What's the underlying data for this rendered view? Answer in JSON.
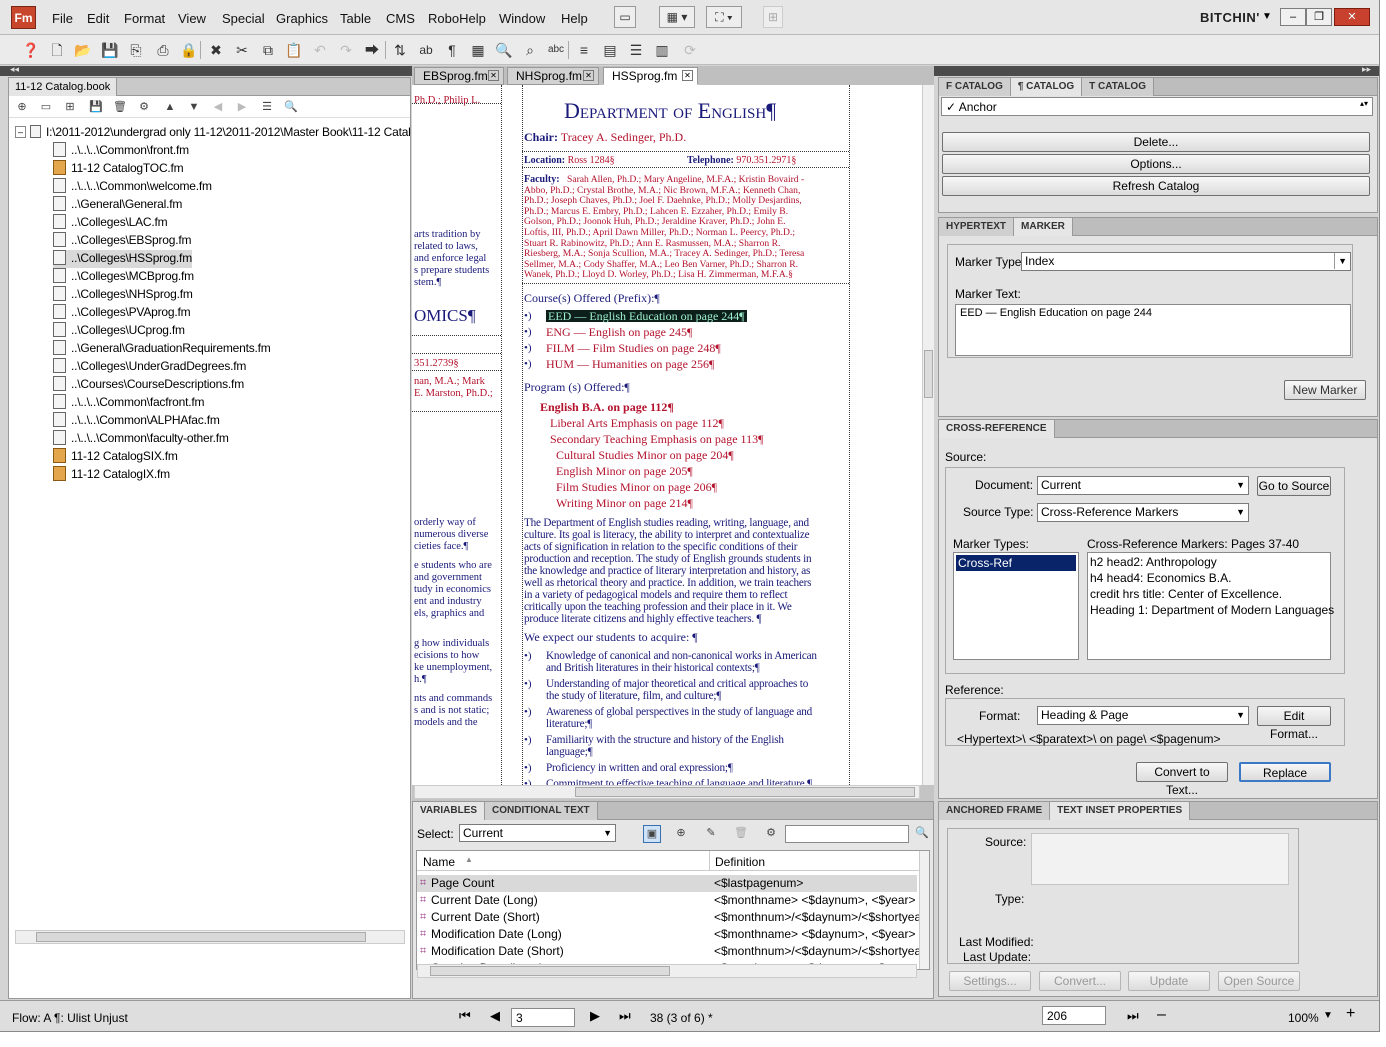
{
  "app": {
    "logo": "Fm",
    "workspace": "BITCHIN'"
  },
  "menu": [
    "File",
    "Edit",
    "Format",
    "View",
    "Special",
    "Graphics",
    "Table",
    "CMS",
    "RoboHelp",
    "Window",
    "Help"
  ],
  "book": {
    "tab": "11-12 Catalog.book",
    "root": "I:\\2011-2012\\undergrad only 11-12\\2011-2012\\Master Book\\11-12 Catalo",
    "files": [
      {
        "name": "..\\..\\..\\Common\\front.fm",
        "fm": false
      },
      {
        "name": "11-12 CatalogTOC.fm",
        "fm": true
      },
      {
        "name": "..\\..\\..\\Common\\welcome.fm",
        "fm": false
      },
      {
        "name": "..\\General\\General.fm",
        "fm": false
      },
      {
        "name": "..\\Colleges\\LAC.fm",
        "fm": false
      },
      {
        "name": "..\\Colleges\\EBSprog.fm",
        "fm": false
      },
      {
        "name": "..\\Colleges\\HSSprog.fm",
        "fm": false,
        "selected": true
      },
      {
        "name": "..\\Colleges\\MCBprog.fm",
        "fm": false
      },
      {
        "name": "..\\Colleges\\NHSprog.fm",
        "fm": false
      },
      {
        "name": "..\\Colleges\\PVAprog.fm",
        "fm": false
      },
      {
        "name": "..\\Colleges\\UCprog.fm",
        "fm": false
      },
      {
        "name": "..\\General\\GraduationRequirements.fm",
        "fm": false
      },
      {
        "name": "..\\Colleges\\UnderGradDegrees.fm",
        "fm": false
      },
      {
        "name": "..\\Courses\\CourseDescriptions.fm",
        "fm": false
      },
      {
        "name": "..\\..\\..\\Common\\facfront.fm",
        "fm": false
      },
      {
        "name": "..\\..\\..\\Common\\ALPHAfac.fm",
        "fm": false
      },
      {
        "name": "..\\..\\..\\Common\\faculty-other.fm",
        "fm": false
      },
      {
        "name": "11-12 CatalogSIX.fm",
        "fm": true
      },
      {
        "name": "11-12 CatalogIX.fm",
        "fm": true
      }
    ]
  },
  "doctabs": [
    "EBSprog.fm",
    "NHSprog.fm",
    "HSSprog.fm"
  ],
  "doc": {
    "left_frag": [
      "Ph.D.; Philip L.",
      "arts tradition by",
      "related to laws,",
      "and enforce legal",
      "s prepare students",
      "stem.¶",
      "OMICS¶",
      "351.2739§",
      "nan, M.A.; Mark",
      "E. Marston, Ph.D.;",
      "orderly way of",
      "numerous diverse",
      "cieties face.¶",
      "e students who are",
      "and government",
      "tudy in economics",
      "ent and industry",
      "els, graphics and",
      "g how individuals",
      "ecisions to how",
      "ke unemployment,",
      "h.¶",
      "nts and commands",
      "s and is not static;",
      "models and the"
    ],
    "title": "Department of English¶",
    "chair_label": "Chair:",
    "chair": "Tracey A. Sedinger, Ph.D.",
    "loc_label": "Location:",
    "loc": "Ross 1284§",
    "tel_label": "Telephone:",
    "tel": "970.351.2971§",
    "faculty_label": "Faculty:",
    "faculty": [
      "Sarah Allen, Ph.D.; Mary Angeline, M.F.A.; Kristin Bovaird -",
      "Abbo, Ph.D.; Crystal Brothe, M.A.; Nic Brown, M.F.A.; Kenneth Chan,",
      "Ph.D.; Joseph Chaves, Ph.D.; Joel F. Daehnke, Ph.D.; Molly Desjardins,",
      "Ph.D.; Marcus E. Embry, Ph.D.; Lahcen E. Ezzaher, Ph.D.; Emily B.",
      "Golson, Ph.D.; Joonok Huh, Ph.D.; Jeraldine Kraver, Ph.D.; John E.",
      "Loftis, III, Ph.D.; April Dawn Miller, Ph.D.; Norman L. Peercy, Ph.D.;",
      "Stuart R. Rabinowitz, Ph.D.; Ann E. Rasmussen, M.A.; Sharron R.",
      "Riesberg, M.A.; Sonja Scullion, M.A.; Tracey A. Sedinger, Ph.D.; Teresa",
      "Sellmer, M.A.; Cody Shaffer, M.A.; Leo Ben Varner, Ph.D.; Sharron R.",
      "Wanek, Ph.D.; Lloyd D. Worley, Ph.D.; Lisa H. Zimmerman, M.F.A.§"
    ],
    "courses_head": "Course(s) Offered (Prefix):¶",
    "courses": [
      "EED — English Education on page 244¶",
      "ENG — English on page 245¶",
      "FILM — Film Studies on page 248¶",
      "HUM — Humanities on page 256¶"
    ],
    "programs_head": "Program (s) Offered:¶",
    "programs": [
      "English B.A. on page 112¶",
      "Liberal Arts Emphasis on page 112¶",
      "Secondary Teaching Emphasis on page 113¶",
      "Cultural Studies Minor on page 204¶",
      "English Minor on page 205¶",
      "Film Studies Minor on page 206¶",
      "Writing Minor on page 214¶"
    ],
    "para": [
      "The Department of English studies reading, writing, language, and",
      "culture. Its goal is literacy, the ability to interpret and contextualize",
      "acts of signification in relation to the specific conditions of their",
      "production and reception. The study of English grounds students in",
      "the knowledge and practice of literary interpretation and history, as",
      "well as rhetorical theory and practice. In addition, we train teachers",
      "in a variety of pedagogical models and require them to reflect",
      "critically upon the teaching profession and their place in it. We",
      "produce literate citizens and highly effective teachers. ¶"
    ],
    "expect": "We expect our students to acquire: ¶",
    "bullets": [
      [
        "Knowledge of canonical and non-canonical works in American",
        "and British literatures in their historical contexts;¶"
      ],
      [
        "Understanding of major theoretical and critical approaches to",
        "the study of literature, film, and culture;¶"
      ],
      [
        "Awareness of global perspectives in the study of language and",
        "literature;¶"
      ],
      [
        "Familiarity with the structure and history of the English",
        "language;¶"
      ],
      [
        "Proficiency in written and oral expression;¶"
      ],
      [
        "Commitment to effective teaching of language and literature ¶"
      ]
    ]
  },
  "variables": {
    "tabs": [
      "VARIABLES",
      "CONDITIONAL TEXT"
    ],
    "select_label": "Select:",
    "select": "Current",
    "col_name": "Name",
    "col_def": "Definition",
    "rows": [
      [
        "Page Count",
        "<$lastpagenum>"
      ],
      [
        "Current Date (Long)",
        "<$monthname> <$daynum>, <$year>"
      ],
      [
        "Current Date (Short)",
        "<$monthnum>/<$daynum>/<$shortyear>"
      ],
      [
        "Modification Date (Long)",
        "<$monthname> <$daynum>, <$year> <$ho"
      ],
      [
        "Modification Date (Short)",
        "<$monthnum>/<$daynum>/<$shortyear>"
      ],
      [
        "Creation Date (Long)",
        "<$monthname> <$daynum>, <$year>"
      ]
    ]
  },
  "catalog": {
    "tabs": [
      "F CATALOG",
      "¶ CATALOG",
      "T CATALOG"
    ],
    "item": "✓ Anchor",
    "delete": "Delete...",
    "options": "Options...",
    "refresh": "Refresh Catalog"
  },
  "marker": {
    "tabs": [
      "HYPERTEXT",
      "MARKER"
    ],
    "type_label": "Marker Type:",
    "type": "Index",
    "text_label": "Marker Text:",
    "text": "EED — English Education on page 244",
    "new": "New Marker"
  },
  "xref": {
    "tab": "CROSS-REFERENCE",
    "source": "Source:",
    "doc_label": "Document:",
    "doc": "Current",
    "goto": "Go to Source",
    "stype_label": "Source Type:",
    "stype": "Cross-Reference Markers",
    "mtypes_label": "Marker Types:",
    "mtype": "Cross-Ref",
    "markers_label": "Cross-Reference Markers: Pages  37-40",
    "markers": [
      "h2 head2: Anthropology",
      "h4 head4: Economics B.A.",
      "credit hrs title: Center of Excellence.",
      "Heading 1: Department of Modern Languages"
    ],
    "ref_label": "Reference:",
    "fmt_label": "Format:",
    "fmt": "Heading & Page",
    "edit": "Edit Format...",
    "fmt_text": "<Hypertext>\\ <$paratext>\\ on page\\ <$pagenum>",
    "convert": "Convert to Text...",
    "replace": "Replace"
  },
  "inset": {
    "tabs": [
      "ANCHORED FRAME",
      "TEXT INSET PROPERTIES"
    ],
    "source": "Source:",
    "type": "Type:",
    "modified": "Last Modified:",
    "updated": "Last Update:",
    "btns": [
      "Settings...",
      "Convert...",
      "Update",
      "Open Source"
    ]
  },
  "status": {
    "flow": "Flow: A  ¶: Ulist Unjust",
    "page": "3",
    "pageinfo": "38 (3 of 6) *",
    "zoomfield": "206",
    "zoom": "100%"
  }
}
